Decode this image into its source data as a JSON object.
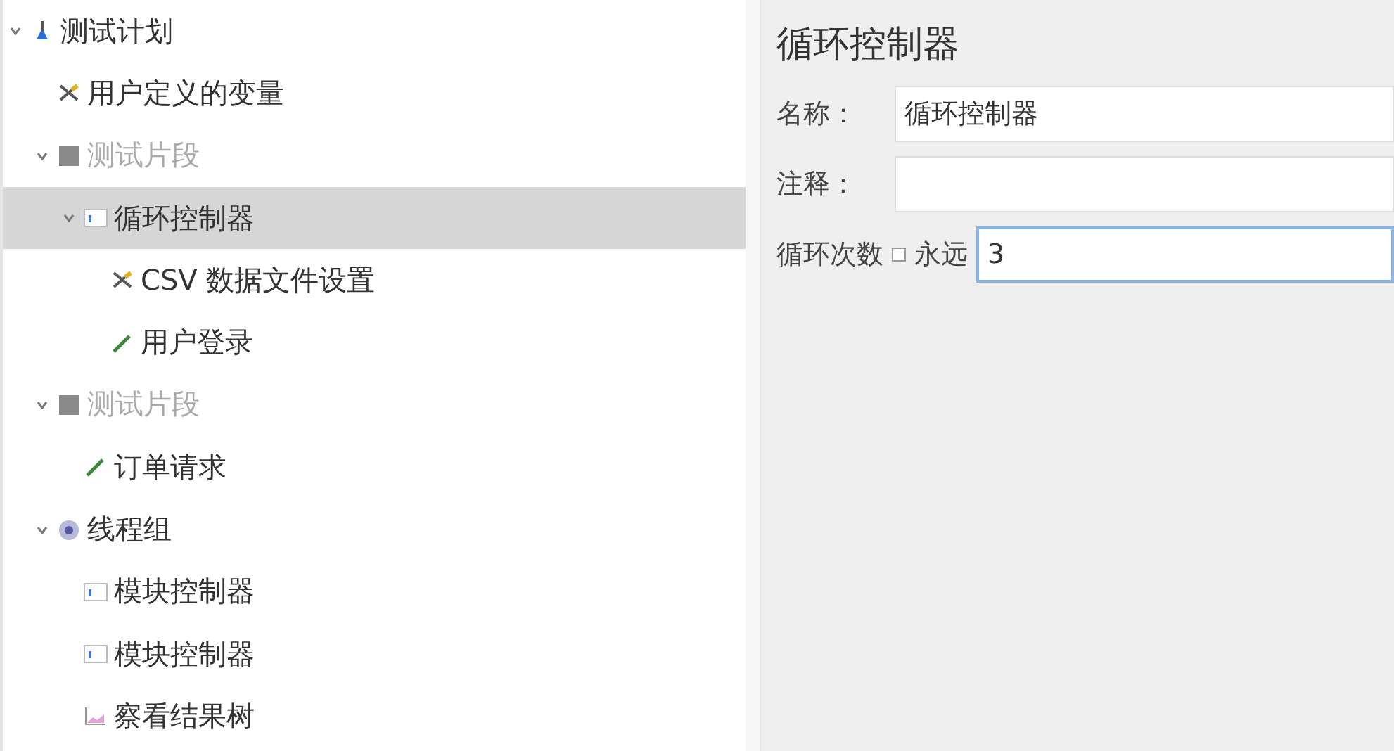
{
  "tree": [
    {
      "label": "测试计划",
      "kind": "plan",
      "expanded": true,
      "selected": false,
      "disabled": false,
      "children": [
        {
          "label": "用户定义的变量",
          "kind": "config",
          "selected": false,
          "disabled": false
        },
        {
          "label": "测试片段",
          "kind": "fragment",
          "expanded": true,
          "selected": false,
          "disabled": true,
          "children": [
            {
              "label": "循环控制器",
              "kind": "controller",
              "expanded": true,
              "selected": true,
              "disabled": false,
              "children": [
                {
                  "label": "CSV 数据文件设置",
                  "kind": "config",
                  "selected": false,
                  "disabled": false
                },
                {
                  "label": "用户登录",
                  "kind": "sampler",
                  "selected": false,
                  "disabled": false
                }
              ]
            }
          ]
        },
        {
          "label": "测试片段",
          "kind": "fragment",
          "expanded": true,
          "selected": false,
          "disabled": true,
          "children": [
            {
              "label": "订单请求",
              "kind": "sampler",
              "selected": false,
              "disabled": false
            }
          ]
        },
        {
          "label": "线程组",
          "kind": "threads",
          "expanded": true,
          "selected": false,
          "disabled": false,
          "children": [
            {
              "label": "模块控制器",
              "kind": "controller",
              "selected": false,
              "disabled": false
            },
            {
              "label": "模块控制器",
              "kind": "controller",
              "selected": false,
              "disabled": false
            },
            {
              "label": "察看结果树",
              "kind": "listener",
              "selected": false,
              "disabled": false
            }
          ]
        }
      ]
    }
  ],
  "panel": {
    "title": "循环控制器",
    "name_label": "名称：",
    "name_value": "循环控制器",
    "comment_label": "注释：",
    "loop_label": "循环次数",
    "forever": {
      "label": "永远",
      "checked": false
    },
    "loop_value": "3"
  }
}
